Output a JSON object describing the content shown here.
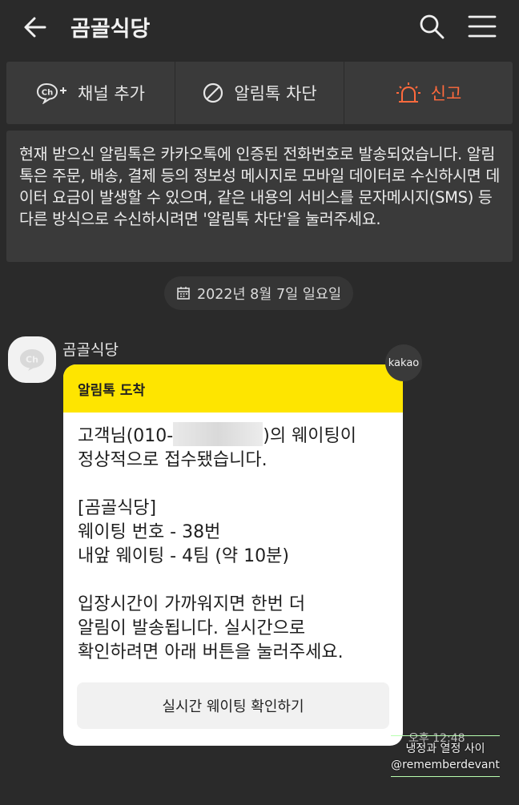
{
  "header": {
    "title": "곰골식당",
    "back_icon": "arrow-left-icon",
    "search_icon": "search-icon",
    "menu_icon": "hamburger-menu-icon"
  },
  "actions": [
    {
      "label": "채널 추가",
      "icon": "channel-add-icon"
    },
    {
      "label": "알림톡 차단",
      "icon": "block-icon"
    },
    {
      "label": "신고",
      "icon": "siren-icon",
      "color": "#ff6a3d"
    }
  ],
  "notice": {
    "text": "현재 받으신 알림톡은 카카오톡에 인증된 전화번호로 발송되었습니다. 알림톡은 주문, 배송, 결제 등의 정보성 메시지로 모바일 데이터로 수신하시면 데이터 요금이 발생할 수 있으며, 같은 내용의 서비스를 문자메시지(SMS) 등 다른 방식으로 수신하시려면 '알림톡 차단'을 눌러주세요."
  },
  "date": {
    "label": "2022년 8월 7일 일요일",
    "icon": "calendar-icon"
  },
  "message": {
    "sender": "곰골식당",
    "badge": "kakao",
    "card_title": "알림톡 도착",
    "line1_prefix": "고객님(010-",
    "line1_suffix": ")의 웨이팅이",
    "line2": "정상적으로 접수됐습니다.",
    "line3": "[곰골식당]",
    "line4": "웨이팅 번호 - 38번",
    "line5": "내앞 웨이팅 - 4팀 (약 10분)",
    "line6": "입장시간이 가까워지면 한번 더",
    "line7": "알림이 발송됩니다. 실시간으로",
    "line8": "확인하려면 아래 버튼을 눌러주세요.",
    "button": "실시간 웨이팅 확인하기",
    "time": "오후 12:48"
  },
  "watermark": {
    "line1": "냉정과 열정 사이",
    "line2": "@rememberdevant"
  },
  "colors": {
    "background": "#2a2a2a",
    "panel": "#3a3a3a",
    "kakao_yellow": "#fee500",
    "report": "#ff6a3d"
  }
}
